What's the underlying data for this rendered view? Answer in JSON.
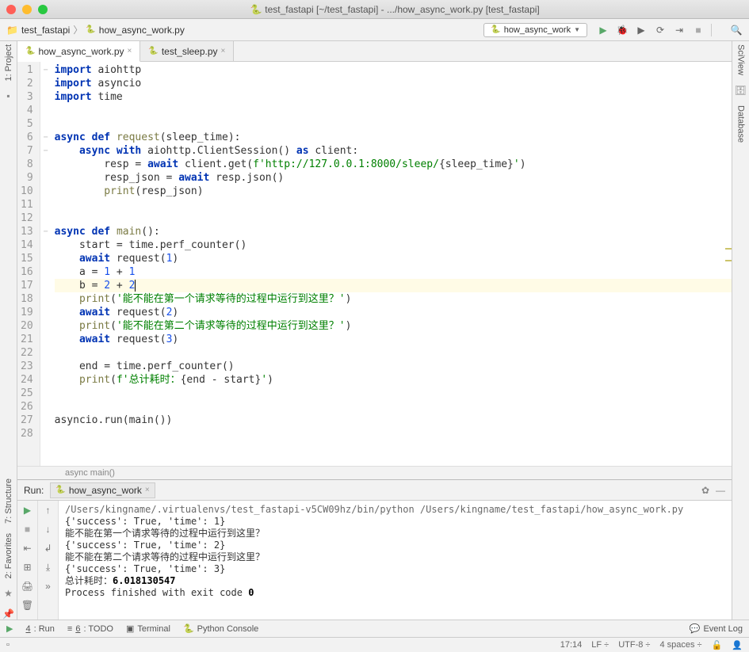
{
  "window_title": "test_fastapi [~/test_fastapi] - .../how_async_work.py [test_fastapi]",
  "breadcrumb": {
    "project": "test_fastapi",
    "file": "how_async_work.py"
  },
  "run_config": "how_async_work",
  "tabs": [
    {
      "label": "how_async_work.py",
      "active": true
    },
    {
      "label": "test_sleep.py",
      "active": false
    }
  ],
  "code": {
    "lines": [
      {
        "n": 1,
        "fold": "−",
        "html": "<span class='kw'>import</span> aiohttp"
      },
      {
        "n": 2,
        "fold": "",
        "html": "<span class='kw'>import</span> asyncio"
      },
      {
        "n": 3,
        "fold": "",
        "html": "<span class='kw'>import</span> time"
      },
      {
        "n": 4,
        "fold": "",
        "html": ""
      },
      {
        "n": 5,
        "fold": "",
        "html": ""
      },
      {
        "n": 6,
        "fold": "−",
        "html": "<span class='kw'>async def</span> <span class='fn'>request</span>(sleep_time):"
      },
      {
        "n": 7,
        "fold": "−",
        "html": "    <span class='kw'>async with</span> aiohttp.ClientSession() <span class='kw'>as</span> client:"
      },
      {
        "n": 8,
        "fold": "",
        "html": "        resp = <span class='kw'>await</span> client.get(<span class='str'>f'http://127.0.0.1:8000/sleep/</span>{sleep_time}<span class='str'>'</span>)"
      },
      {
        "n": 9,
        "fold": "",
        "html": "        resp_json = <span class='kw'>await</span> resp.json()"
      },
      {
        "n": 10,
        "fold": "",
        "html": "        <span class='fn'>print</span>(resp_json)"
      },
      {
        "n": 11,
        "fold": "",
        "html": ""
      },
      {
        "n": 12,
        "fold": "",
        "html": ""
      },
      {
        "n": 13,
        "fold": "−",
        "html": "<span class='kw'>async def</span> <span class='fn'>main</span>():"
      },
      {
        "n": 14,
        "fold": "",
        "html": "    start = time.perf_counter()"
      },
      {
        "n": 15,
        "fold": "",
        "html": "    <span class='kw'>await</span> request(<span class='num'>1</span>)"
      },
      {
        "n": 16,
        "fold": "",
        "html": "    a = <span class='num'>1</span> + <span class='num'>1</span>"
      },
      {
        "n": 17,
        "fold": "",
        "current": true,
        "html": "    b = <span class='num'>2</span> + <span class='num'>2</span><span class='cursor-caret'></span>"
      },
      {
        "n": 18,
        "fold": "",
        "html": "    <span class='fn'>print</span>(<span class='str'>'能不能在第一个请求等待的过程中运行到这里？'</span>)"
      },
      {
        "n": 19,
        "fold": "",
        "html": "    <span class='kw'>await</span> request(<span class='num'>2</span>)"
      },
      {
        "n": 20,
        "fold": "",
        "html": "    <span class='fn'>print</span>(<span class='str'>'能不能在第二个请求等待的过程中运行到这里？'</span>)"
      },
      {
        "n": 21,
        "fold": "",
        "html": "    <span class='kw'>await</span> request(<span class='num'>3</span>)"
      },
      {
        "n": 22,
        "fold": "",
        "html": ""
      },
      {
        "n": 23,
        "fold": "",
        "html": "    end = time.perf_counter()"
      },
      {
        "n": 24,
        "fold": "",
        "html": "    <span class='fn'>print</span>(<span class='str'>f'总计耗时：</span>{end - start}<span class='str'>'</span>)"
      },
      {
        "n": 25,
        "fold": "",
        "html": ""
      },
      {
        "n": 26,
        "fold": "",
        "html": ""
      },
      {
        "n": 27,
        "fold": "",
        "html": "asyncio.run(main())"
      },
      {
        "n": 28,
        "fold": "",
        "html": ""
      }
    ]
  },
  "editor_crumb": "async main()",
  "run_panel": {
    "title": "Run:",
    "tab": "how_async_work",
    "output": [
      {
        "cls": "path",
        "text": "/Users/kingname/.virtualenvs/test_fastapi-v5CW09hz/bin/python /Users/kingname/test_fastapi/how_async_work.py"
      },
      {
        "cls": "",
        "text": "{'success': True, 'time': 1}"
      },
      {
        "cls": "",
        "text": "能不能在第一个请求等待的过程中运行到这里？"
      },
      {
        "cls": "",
        "text": "{'success': True, 'time': 2}"
      },
      {
        "cls": "",
        "text": "能不能在第二个请求等待的过程中运行到这里？"
      },
      {
        "cls": "",
        "text": "{'success': True, 'time': 3}"
      },
      {
        "cls": "",
        "html": "总计耗时：<span class='bold'>6.018130547</span>"
      },
      {
        "cls": "",
        "text": ""
      },
      {
        "cls": "",
        "html": "Process finished with exit code <span class='bold'>0</span>"
      }
    ]
  },
  "left_tools": [
    "1: Project",
    "7: Structure",
    "2: Favorites"
  ],
  "right_tools": [
    "SciView",
    "Database"
  ],
  "bottom_bar": {
    "items": [
      "4: Run",
      "6: TODO",
      "Terminal",
      "Python Console"
    ],
    "event_log": "Event Log"
  },
  "status": {
    "pos": "17:14",
    "line_sep": "LF",
    "encoding": "UTF-8",
    "indent": "4 spaces"
  }
}
